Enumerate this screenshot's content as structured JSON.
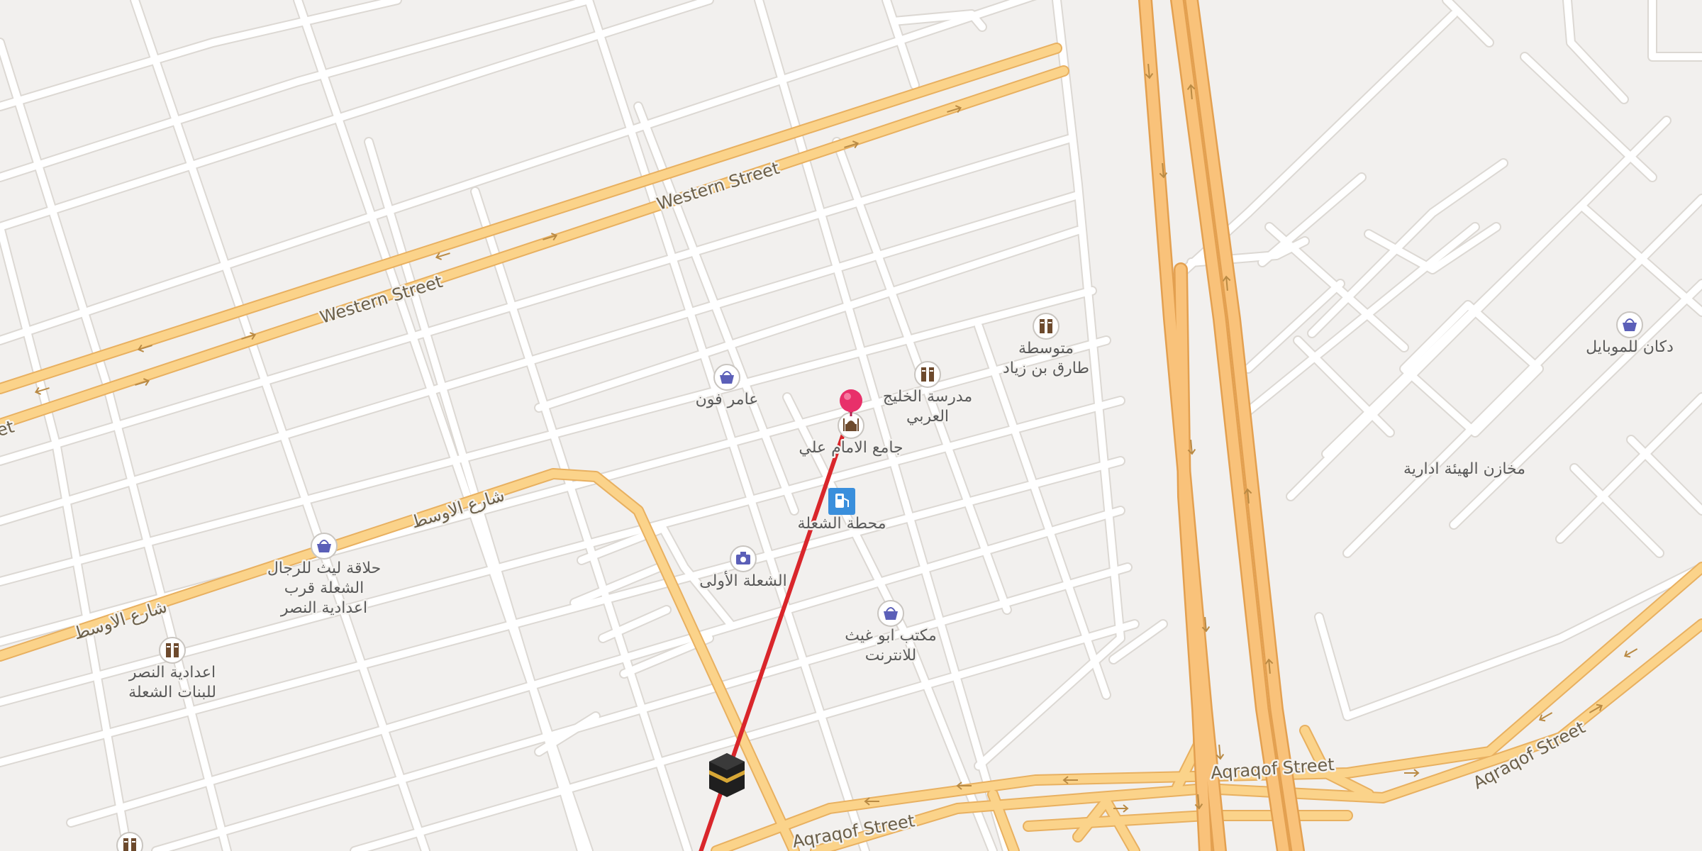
{
  "streets": [
    {
      "label": "Western Street"
    },
    {
      "label": "Western Street"
    },
    {
      "label": "شارع الاوسط"
    },
    {
      "label": "شارع الاوسط"
    },
    {
      "label": "Aqraqof Street"
    },
    {
      "label": "Aqraqof Street"
    },
    {
      "label": "Aqraqof Street"
    },
    {
      "label": "et"
    }
  ],
  "pois": [
    {
      "type": "shop",
      "icon": "shopping-basket-icon",
      "lines": [
        "عامر فون"
      ]
    },
    {
      "type": "school",
      "icon": "school-icon",
      "lines": [
        "مدرسة الخليج",
        "العربي"
      ]
    },
    {
      "type": "school",
      "icon": "school-icon",
      "lines": [
        "متوسطة",
        "طارق بن زياد"
      ]
    },
    {
      "type": "mosque",
      "icon": "mosque-icon",
      "lines": [
        "جامع الامام علي"
      ]
    },
    {
      "type": "fuel",
      "icon": "fuel-pump-icon",
      "lines": [
        "محطة الشعلة"
      ]
    },
    {
      "type": "photo",
      "icon": "camera-icon",
      "lines": [
        "الشعلة الأولى"
      ]
    },
    {
      "type": "shop",
      "icon": "shopping-basket-icon",
      "lines": [
        "حلاقة ليث للرجال",
        "الشعلة قرب",
        "اعدادية النصر"
      ]
    },
    {
      "type": "school",
      "icon": "school-icon",
      "lines": [
        "اعدادية النصر",
        "للبنات الشعلة"
      ]
    },
    {
      "type": "shop",
      "icon": "shopping-basket-icon",
      "lines": [
        "مكتب ابو غيث",
        "للانترنت"
      ]
    },
    {
      "type": "shop",
      "icon": "shopping-basket-icon",
      "lines": [
        "دكان للموبايل"
      ]
    },
    {
      "type": "area",
      "icon": "",
      "lines": [
        "مخازن الهيئة ادارية"
      ]
    },
    {
      "type": "school",
      "icon": "school-icon",
      "lines": [
        ""
      ]
    }
  ],
  "colors": {
    "background": "#f2f0ee",
    "minor_road": "#ffffff",
    "minor_road_casing": "#dcd8d3",
    "major_road": "#fbd38a",
    "major_road_casing": "#e8b060",
    "highway": "#f9c27a",
    "highway_casing": "#e3a050",
    "direction_line": "#d9262b",
    "pin": "#e8306a",
    "poi_icon_shop": "#5b5fb8",
    "poi_icon_school": "#6d4a2d",
    "poi_icon_fuel": "#3a8fdc"
  },
  "markers": {
    "location_pin": "red-pin-icon",
    "kaaba": "kaaba-icon"
  }
}
